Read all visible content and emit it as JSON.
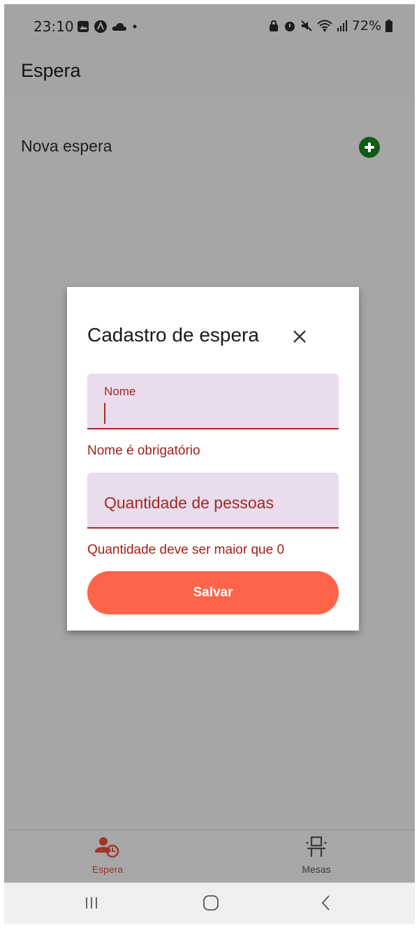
{
  "status_bar": {
    "time": "23:10",
    "battery": "72%"
  },
  "app_bar": {
    "title": "Espera"
  },
  "main": {
    "nova_espera_label": "Nova espera"
  },
  "dialog": {
    "title": "Cadastro de espera",
    "nome_label": "Nome",
    "nome_value": "",
    "nome_error": "Nome é obrigatório",
    "quantidade_placeholder": "Quantidade de pessoas",
    "quantidade_error": "Quantidade deve ser maior que 0",
    "save_label": "Salvar"
  },
  "bottom_nav": {
    "items": [
      {
        "label": "Espera",
        "icon": "person-clock-icon",
        "active": true
      },
      {
        "label": "Mesas",
        "icon": "chair-icon",
        "active": false
      }
    ]
  },
  "colors": {
    "accent": "#fd6449",
    "error": "#b3261e",
    "add_button": "#0f5c17",
    "field_fill": "#e9dcec",
    "scrim": "#a6a6a6"
  }
}
